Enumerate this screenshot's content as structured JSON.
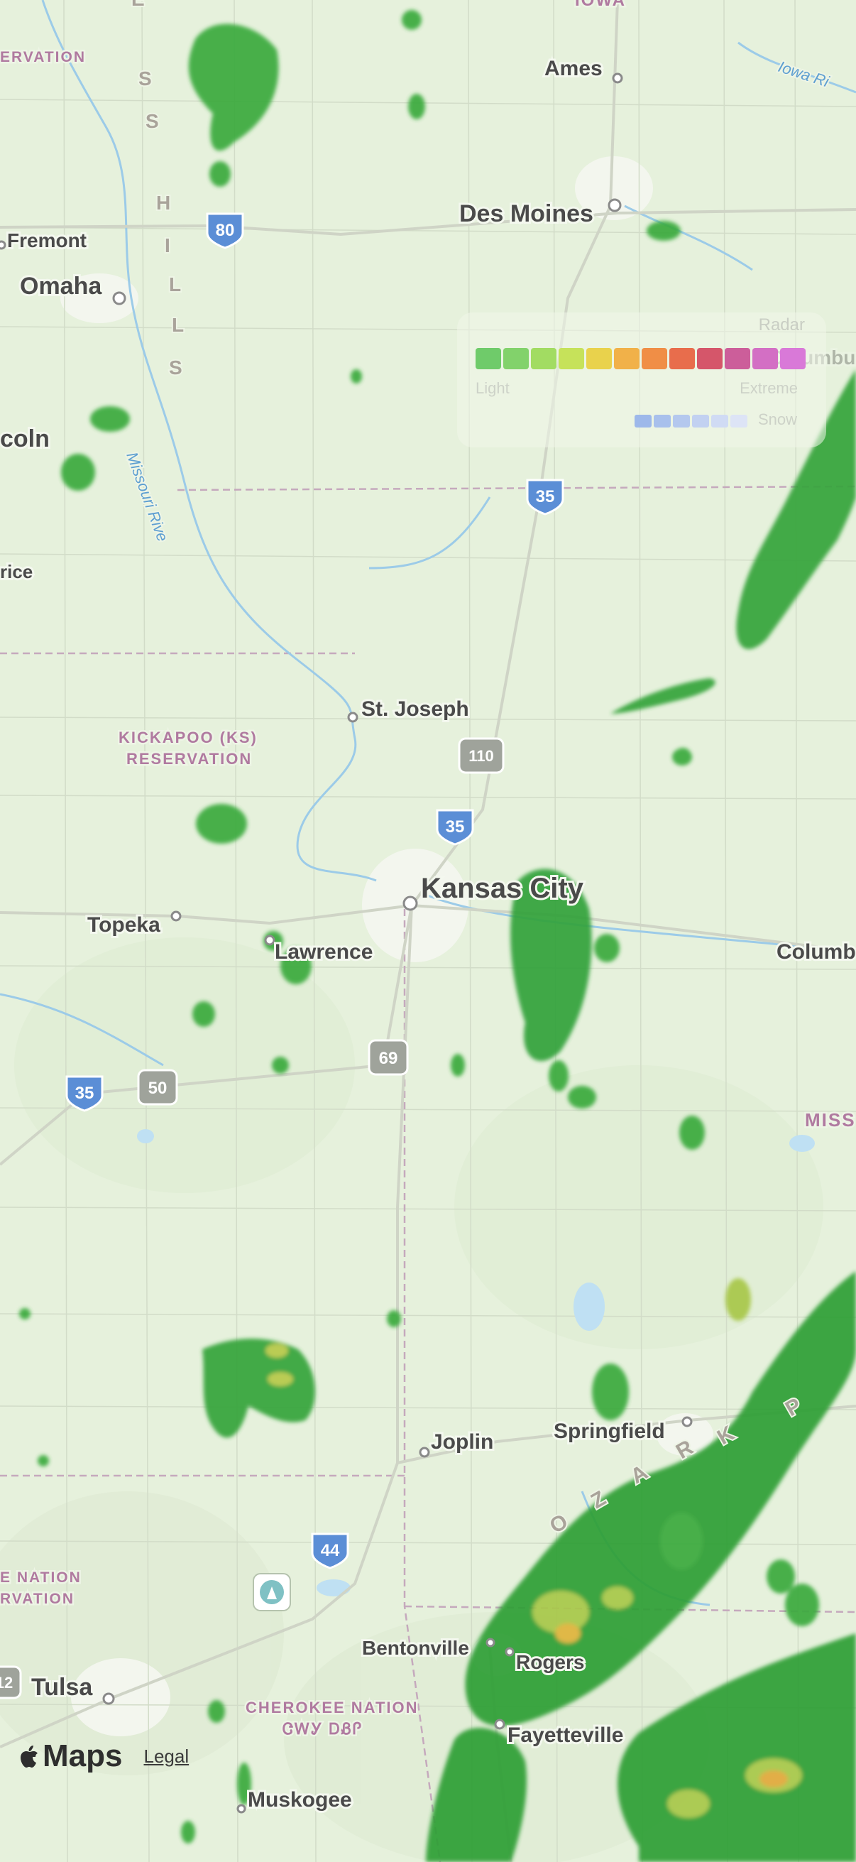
{
  "cities": [
    {
      "id": "ames",
      "name": "Ames"
    },
    {
      "id": "des-moines",
      "name": "Des Moines"
    },
    {
      "id": "fremont",
      "name": "Fremont"
    },
    {
      "id": "omaha",
      "name": "Omaha"
    },
    {
      "id": "lincoln",
      "name": "coln"
    },
    {
      "id": "beatrice",
      "name": "rice"
    },
    {
      "id": "st-joseph",
      "name": "St. Joseph"
    },
    {
      "id": "topeka",
      "name": "Topeka"
    },
    {
      "id": "lawrence",
      "name": "Lawrence"
    },
    {
      "id": "kansas-city",
      "name": "Kansas City"
    },
    {
      "id": "columbia",
      "name": "Columb"
    },
    {
      "id": "columbus",
      "name": "Columbu"
    },
    {
      "id": "springfield",
      "name": "Springfield"
    },
    {
      "id": "joplin",
      "name": "Joplin"
    },
    {
      "id": "bentonville",
      "name": "Bentonville"
    },
    {
      "id": "rogers",
      "name": "Rogers"
    },
    {
      "id": "fayetteville",
      "name": "Fayetteville"
    },
    {
      "id": "tulsa",
      "name": "Tulsa"
    },
    {
      "id": "muskogee",
      "name": "Muskogee"
    }
  ],
  "region_labels": {
    "iowa": "IOWA",
    "reservation_top": "ERVATION",
    "kickapoo_line1": "KICKAPOO (KS)",
    "kickapoo_line2": "RESERVATION",
    "missouri": "MISS",
    "nation_line1": "E NATION",
    "nation_line2": "RVATION",
    "cherokee_line1": "CHEROKEE NATION",
    "cherokee_line2": "ᏣᎳᎩ ᎠᏰᎵ",
    "loess_hills_letters": [
      "E",
      "S",
      "S",
      "H",
      "I",
      "L",
      "L",
      "S"
    ],
    "ozark_letters": [
      "O",
      "Z",
      "A",
      "R",
      "K",
      "P"
    ]
  },
  "water_labels": {
    "missouri_river": "Missouri Rive",
    "iowa_river": "Iowa Ri"
  },
  "highways": {
    "i80": "80",
    "i35_north": "35",
    "i35_kc": "35",
    "i35_sw": "35",
    "i44": "44",
    "us110": "110",
    "us69": "69",
    "us50": "50",
    "us412": "12"
  },
  "legend": {
    "title": "Radar",
    "light": "Light",
    "extreme": "Extreme",
    "snow": "Snow",
    "rain_colors": [
      "#6fcb6a",
      "#82d26b",
      "#a2dc62",
      "#c6e25a",
      "#e9d24c",
      "#f1b149",
      "#f08e46",
      "#e86d4c",
      "#d5566a",
      "#cc5e9a",
      "#d36fc4",
      "#d979d8"
    ],
    "snow_colors": [
      "#9db8ea",
      "#a8c0ec",
      "#b4c8ee",
      "#c2d1f1",
      "#d0dbf4",
      "#dde4f6"
    ]
  },
  "attribution": {
    "maps_label": "Maps",
    "legal_label": "Legal"
  }
}
